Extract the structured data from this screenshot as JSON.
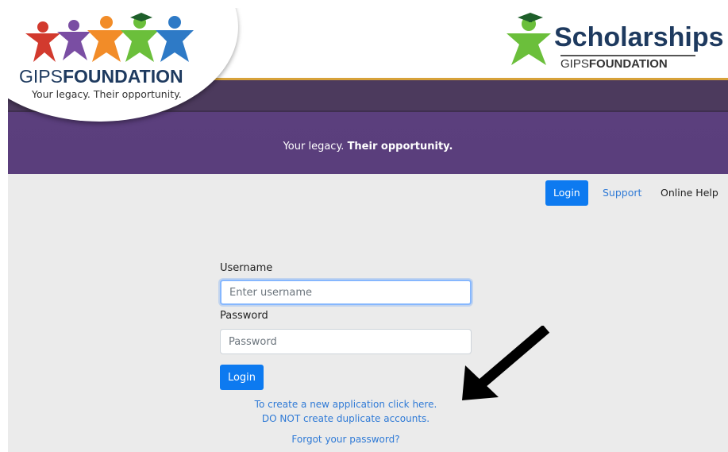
{
  "header": {
    "logo": {
      "name_light": "GIPS",
      "name_bold": "FOUNDATION",
      "tagline": "Your legacy. Their opportunity."
    },
    "scholarships": {
      "title": "Scholarships",
      "sub_light": "GIPS",
      "sub_bold": "FOUNDATION"
    },
    "banner": {
      "tagline_light": "Your legacy.",
      "tagline_bold": "Their opportunity."
    }
  },
  "nav": {
    "login": "Login",
    "support": "Support",
    "help": "Online Help"
  },
  "form": {
    "username_label": "Username",
    "username_placeholder": "Enter username",
    "username_value": "",
    "password_label": "Password",
    "password_placeholder": "Password",
    "password_value": "",
    "login_button": "Login",
    "create_link": "To create a new application click here.",
    "duplicate_note": "DO NOT create duplicate accounts.",
    "forgot_link": "Forgot your password?"
  },
  "colors": {
    "primary": "#0d7af0",
    "link": "#2f7ad6",
    "banner_purple": "#5a3e7c",
    "gold": "#d7a23a",
    "navy": "#1e3a5f"
  },
  "icons": {
    "logo_figures": [
      "person-red",
      "person-purple",
      "person-orange",
      "person-green-grad-cap",
      "person-blue"
    ],
    "scholarship_figure": "person-green-grad-cap",
    "annotation": "arrow-down-left"
  }
}
